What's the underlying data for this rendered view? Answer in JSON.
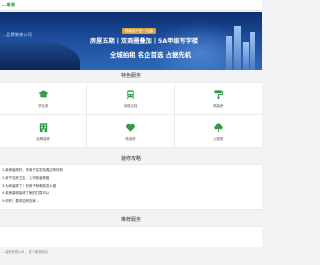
{
  "header": {
    "logo_text": "…南装"
  },
  "banner": {
    "brand": "…品牌装修公司",
    "tag": "精装修户型一站通",
    "headline": "房屋五期丨双商圈叠加丨5A甲级写字楼",
    "slogan": "全城拍租 名企首选 占据先机"
  },
  "features": {
    "title": "特色服务",
    "items": [
      {
        "label": "学区房",
        "icon": "school-icon",
        "color": "#2f9a48"
      },
      {
        "label": "地铁沿线",
        "icon": "subway-icon",
        "color": "#2f9a48"
      },
      {
        "label": "精装房",
        "icon": "roller-icon",
        "color": "#2f9a48"
      },
      {
        "label": "品牌装修",
        "icon": "building-icon",
        "color": "#2f9a48"
      },
      {
        "label": "精选房",
        "icon": "heart-icon",
        "color": "#2f9a48"
      },
      {
        "label": "公园房",
        "icon": "tree-icon",
        "color": "#2f9a48"
      }
    ]
  },
  "guide": {
    "title": "装修攻略",
    "items": [
      "1.新房装修好，作用于住宅及周边有好转",
      "2.房子交房卫生：上市前装修做",
      "3.为你装修了！好房子和邮政怎么做",
      "4.老房装修装修了家的打算可以",
      "5.你好！要求如何在家…"
    ]
  },
  "recommend": {
    "title": "推荐服务"
  },
  "footer": {
    "text": "…装修有限公司 ，首个服务网站"
  }
}
